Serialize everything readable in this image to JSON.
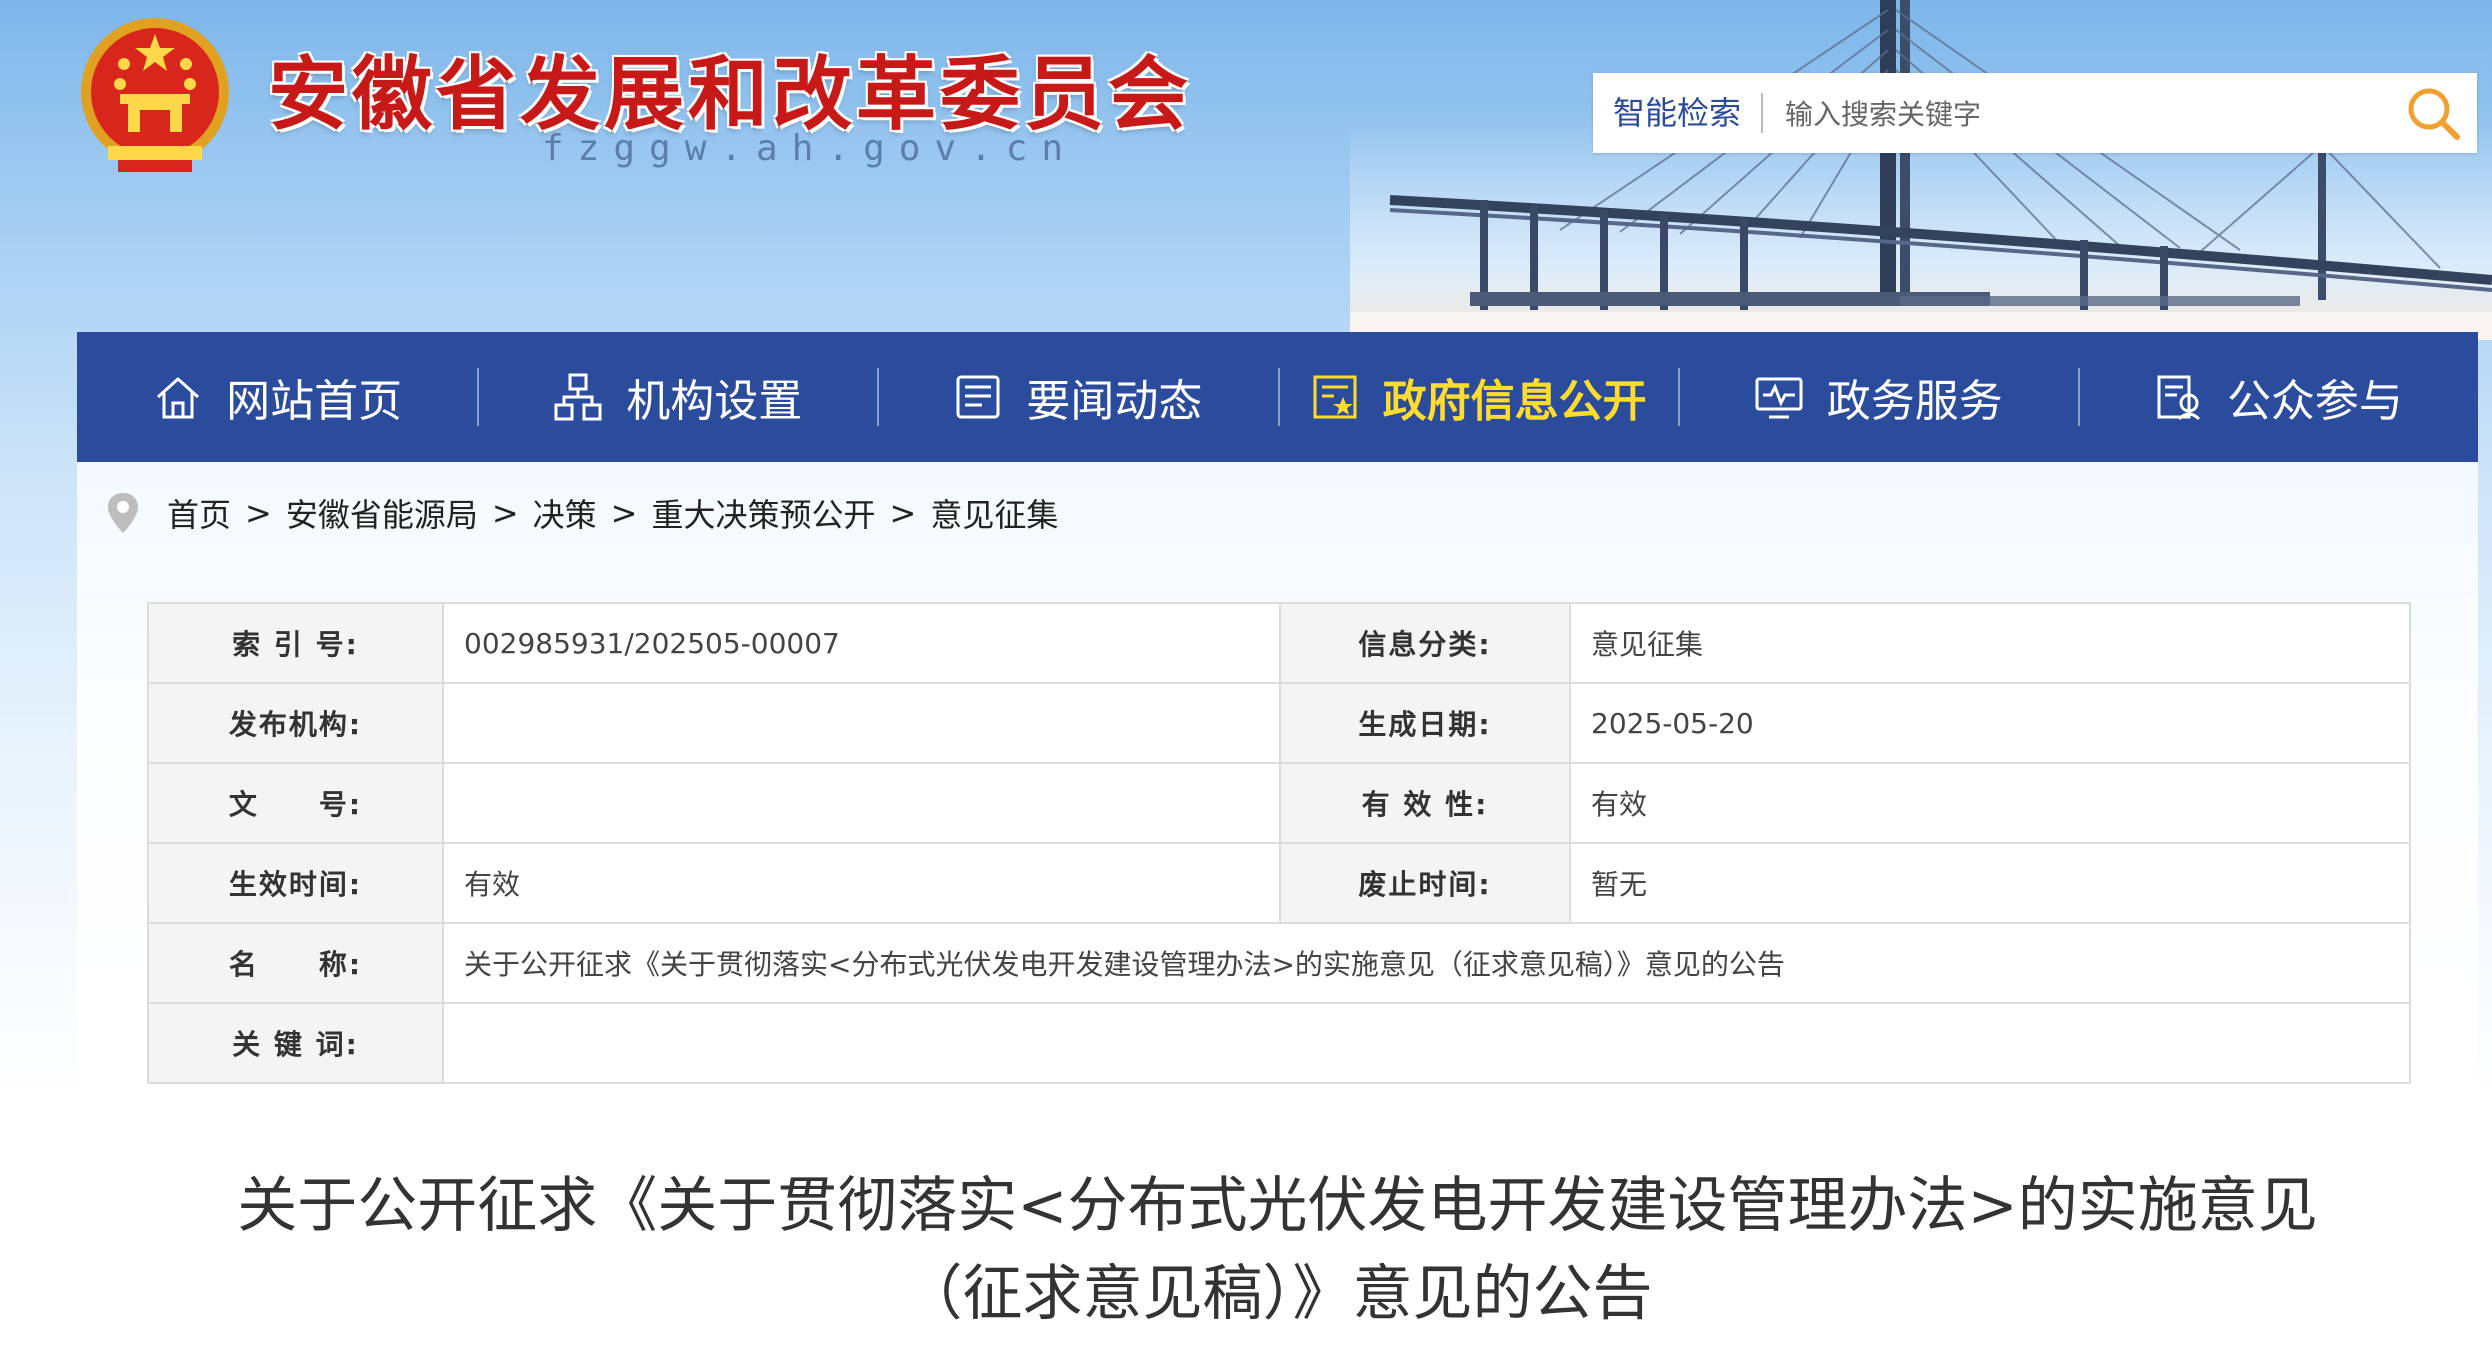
{
  "header": {
    "site_title": "安徽省发展和改革委员会",
    "site_domain": "fzggw.ah.gov.cn"
  },
  "search": {
    "label": "智能检索",
    "placeholder": "输入搜索关键字",
    "icon": "search-icon"
  },
  "nav": {
    "items": [
      {
        "label": "网站首页",
        "icon": "home-icon"
      },
      {
        "label": "机构设置",
        "icon": "org-chart-icon"
      },
      {
        "label": "要闻动态",
        "icon": "news-icon"
      },
      {
        "label": "政府信息公开",
        "icon": "info-disclosure-icon",
        "active": true
      },
      {
        "label": "政务服务",
        "icon": "service-monitor-icon"
      },
      {
        "label": "公众参与",
        "icon": "public-participation-icon"
      }
    ],
    "active_color": "#ffdc2e",
    "background": "#2b4c9c"
  },
  "breadcrumb": {
    "items": [
      "首页",
      "安徽省能源局",
      "决策",
      "重大决策预公开",
      "意见征集"
    ],
    "separator": ">"
  },
  "meta": {
    "index_no_label": "索 引 号:",
    "index_no": "002985931/202505-00007",
    "category_label": "信息分类:",
    "category": "意见征集",
    "publisher_label": "发布机构:",
    "publisher": "",
    "date_label": "生成日期:",
    "date": "2025-05-20",
    "doc_no_label": "文　　号:",
    "doc_no": "",
    "validity_label": "有 效 性:",
    "validity": "有效",
    "effective_label": "生效时间:",
    "effective": "有效",
    "repeal_label": "废止时间:",
    "repeal": "暂无",
    "name_label": "名　　称:",
    "name": "关于公开征求《关于贯彻落实<分布式光伏发电开发建设管理办法>的实施意见（征求意见稿）》意见的公告",
    "keywords_label": "关 键 词:",
    "keywords": ""
  },
  "article": {
    "title_line1": "关于公开征求《关于贯彻落实<分布式光伏发电开发建设管理办法>的实施意见",
    "title_line2": "（征求意见稿）》意见的公告"
  }
}
